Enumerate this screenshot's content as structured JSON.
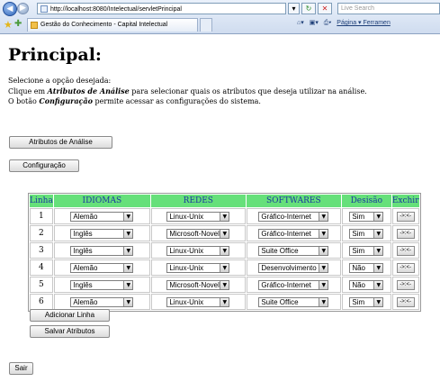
{
  "browser": {
    "url": "http://localhost:8080/Intelectual/servletPrincipal",
    "search_placeholder": "Live Search",
    "tab_title": "Gestão do Conhecimento - Capital Intelectual",
    "tools": "Página ▾  Ferramen"
  },
  "page": {
    "title": "Principal:",
    "line1": "Selecione a opção desejada:",
    "line2_pre": "Clique em ",
    "line2_bold": "Atributos de Análise",
    "line2_post": " para selecionar quais os atributos que deseja utilizar na análise.",
    "line3_pre": "O botão ",
    "line3_bold": "Configuração",
    "line3_post": " permite acessar as configurações do sistema."
  },
  "buttons": {
    "atributos": "Atributos de Análise",
    "configuracao": "Configuração",
    "adicionar": "Adicionar Linha",
    "salvar": "Salvar Atributos",
    "sair": "Sair"
  },
  "table": {
    "headers": [
      "Linha",
      "IDIOMAS",
      "REDES",
      "SOFTWARES",
      "Desisão",
      "Exchir"
    ],
    "rows": [
      {
        "num": "1",
        "idioma": "Alemão",
        "rede": "Linux-Unix",
        "software": "Gráfico-Internet",
        "decisao": "Sim",
        "excluir": "->:<-"
      },
      {
        "num": "2",
        "idioma": "Inglês",
        "rede": "Microsoft-Novel",
        "software": "Gráfico-Internet",
        "decisao": "Sim",
        "excluir": "->:<-"
      },
      {
        "num": "3",
        "idioma": "Inglês",
        "rede": "Linux-Unix",
        "software": "Suite Office",
        "decisao": "Sim",
        "excluir": "->:<-"
      },
      {
        "num": "4",
        "idioma": "Alemão",
        "rede": "Linux-Unix",
        "software": "Desenvolvimento",
        "decisao": "Não",
        "excluir": "->:<-"
      },
      {
        "num": "5",
        "idioma": "Inglês",
        "rede": "Microsoft-Novel",
        "software": "Gráfico-Internet",
        "decisao": "Não",
        "excluir": "->:<-"
      },
      {
        "num": "6",
        "idioma": "Alemão",
        "rede": "Linux-Unix",
        "software": "Suite Office",
        "decisao": "Sim",
        "excluir": "->:<-"
      }
    ]
  },
  "colors": {
    "header_bg": "#66e07a",
    "header_text": "#1a3a9e"
  }
}
